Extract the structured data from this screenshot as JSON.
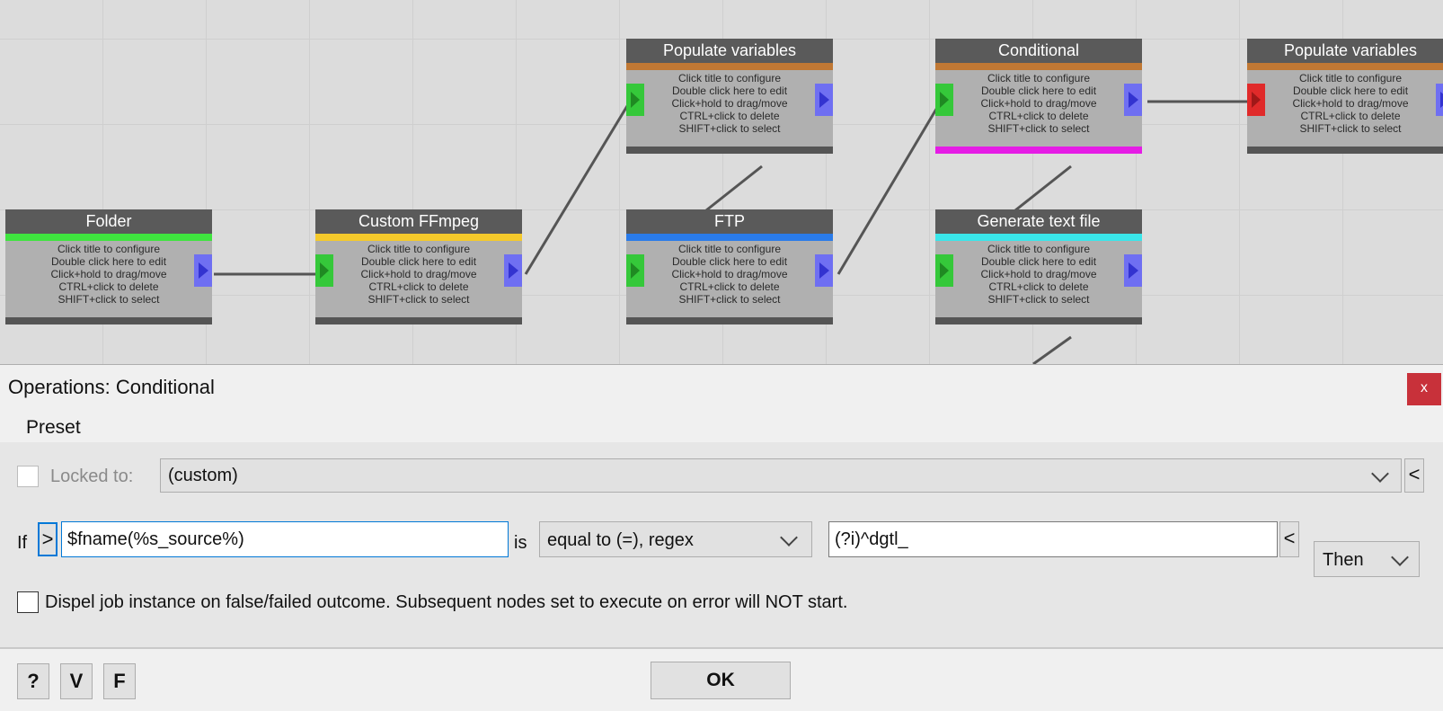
{
  "canvas": {
    "nodes": [
      {
        "title": "Folder",
        "accent": "#3fe43f",
        "input_pin": "none"
      },
      {
        "title": "Custom FFmpeg",
        "accent": "#f4c92b",
        "input_pin": "green"
      },
      {
        "title": "Populate variables",
        "accent": "#c07834",
        "input_pin": "green"
      },
      {
        "title": "FTP",
        "accent": "#2a7be9",
        "input_pin": "green"
      },
      {
        "title": "Conditional",
        "accent": "#c07834",
        "accent_bottom": "#e51ce5",
        "input_pin": "green"
      },
      {
        "title": "Generate text file",
        "accent": "#3ae6ea",
        "input_pin": "green"
      },
      {
        "title": "Populate variables",
        "accent": "#c07834",
        "input_pin": "red"
      }
    ],
    "help_lines": [
      "Click title to configure",
      "Double click here to edit",
      "Click+hold to drag/move",
      "CTRL+click to delete",
      "SHIFT+click to select"
    ]
  },
  "dialog": {
    "title": "Operations: Conditional",
    "close_label": "x",
    "menu_preset": "Preset",
    "locked_label": "Locked to:",
    "preset_value": "(custom)",
    "preset_back": "<",
    "if_label": "If",
    "toggle_label": ">",
    "condition_value": "$fname(%s_source%)",
    "is_label": "is",
    "operator_value": "equal to (=), regex",
    "compare_value": "(?i)^dgtl_",
    "compare_back": "<",
    "then_value": "Then",
    "dispel_label": "Dispel job instance on false/failed outcome. Subsequent nodes set to execute on error will NOT start."
  },
  "footer": {
    "help_label": "?",
    "v_label": "V",
    "f_label": "F",
    "ok_label": "OK"
  }
}
